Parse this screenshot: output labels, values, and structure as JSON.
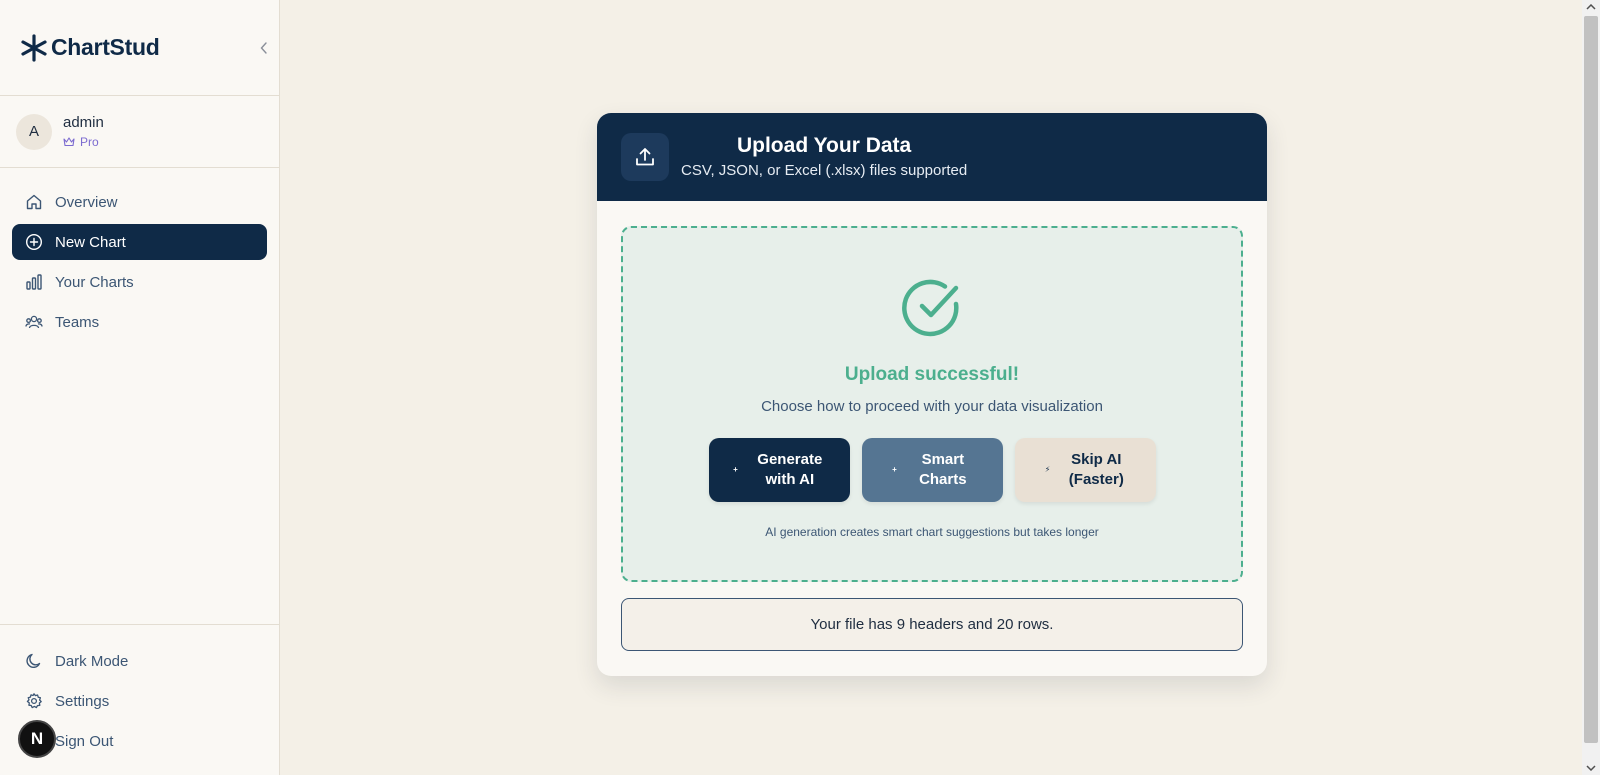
{
  "brand": {
    "name": "ChartStud"
  },
  "user": {
    "avatar_initial": "A",
    "name": "admin",
    "plan": "Pro"
  },
  "nav": {
    "items": [
      {
        "label": "Overview",
        "icon": "home-icon"
      },
      {
        "label": "New Chart",
        "icon": "plus-circle-icon",
        "active": true
      },
      {
        "label": "Your Charts",
        "icon": "bar-chart-icon"
      },
      {
        "label": "Teams",
        "icon": "users-icon"
      }
    ],
    "bottom": [
      {
        "label": "Dark Mode",
        "icon": "moon-icon"
      },
      {
        "label": "Settings",
        "icon": "gear-icon"
      },
      {
        "label": "Sign Out",
        "icon": "sign-out-icon"
      }
    ]
  },
  "next_badge": "N",
  "upload": {
    "title": "Upload Your Data",
    "subtitle": "CSV, JSON, or Excel (.xlsx) files supported",
    "success_title": "Upload successful!",
    "success_subtitle": "Choose how to proceed with your data visualization",
    "buttons": {
      "generate_ai": "Generate with AI",
      "smart_charts": "Smart Charts",
      "skip_ai": "Skip AI (Faster)"
    },
    "ai_note": "AI generation creates smart chart suggestions but takes longer",
    "file_info": "Your file has 9 headers and 20 rows."
  },
  "colors": {
    "primary": "#0f2a47",
    "success": "#4caf8e",
    "secondary_button": "#557592",
    "background": "#f4f0e7"
  }
}
